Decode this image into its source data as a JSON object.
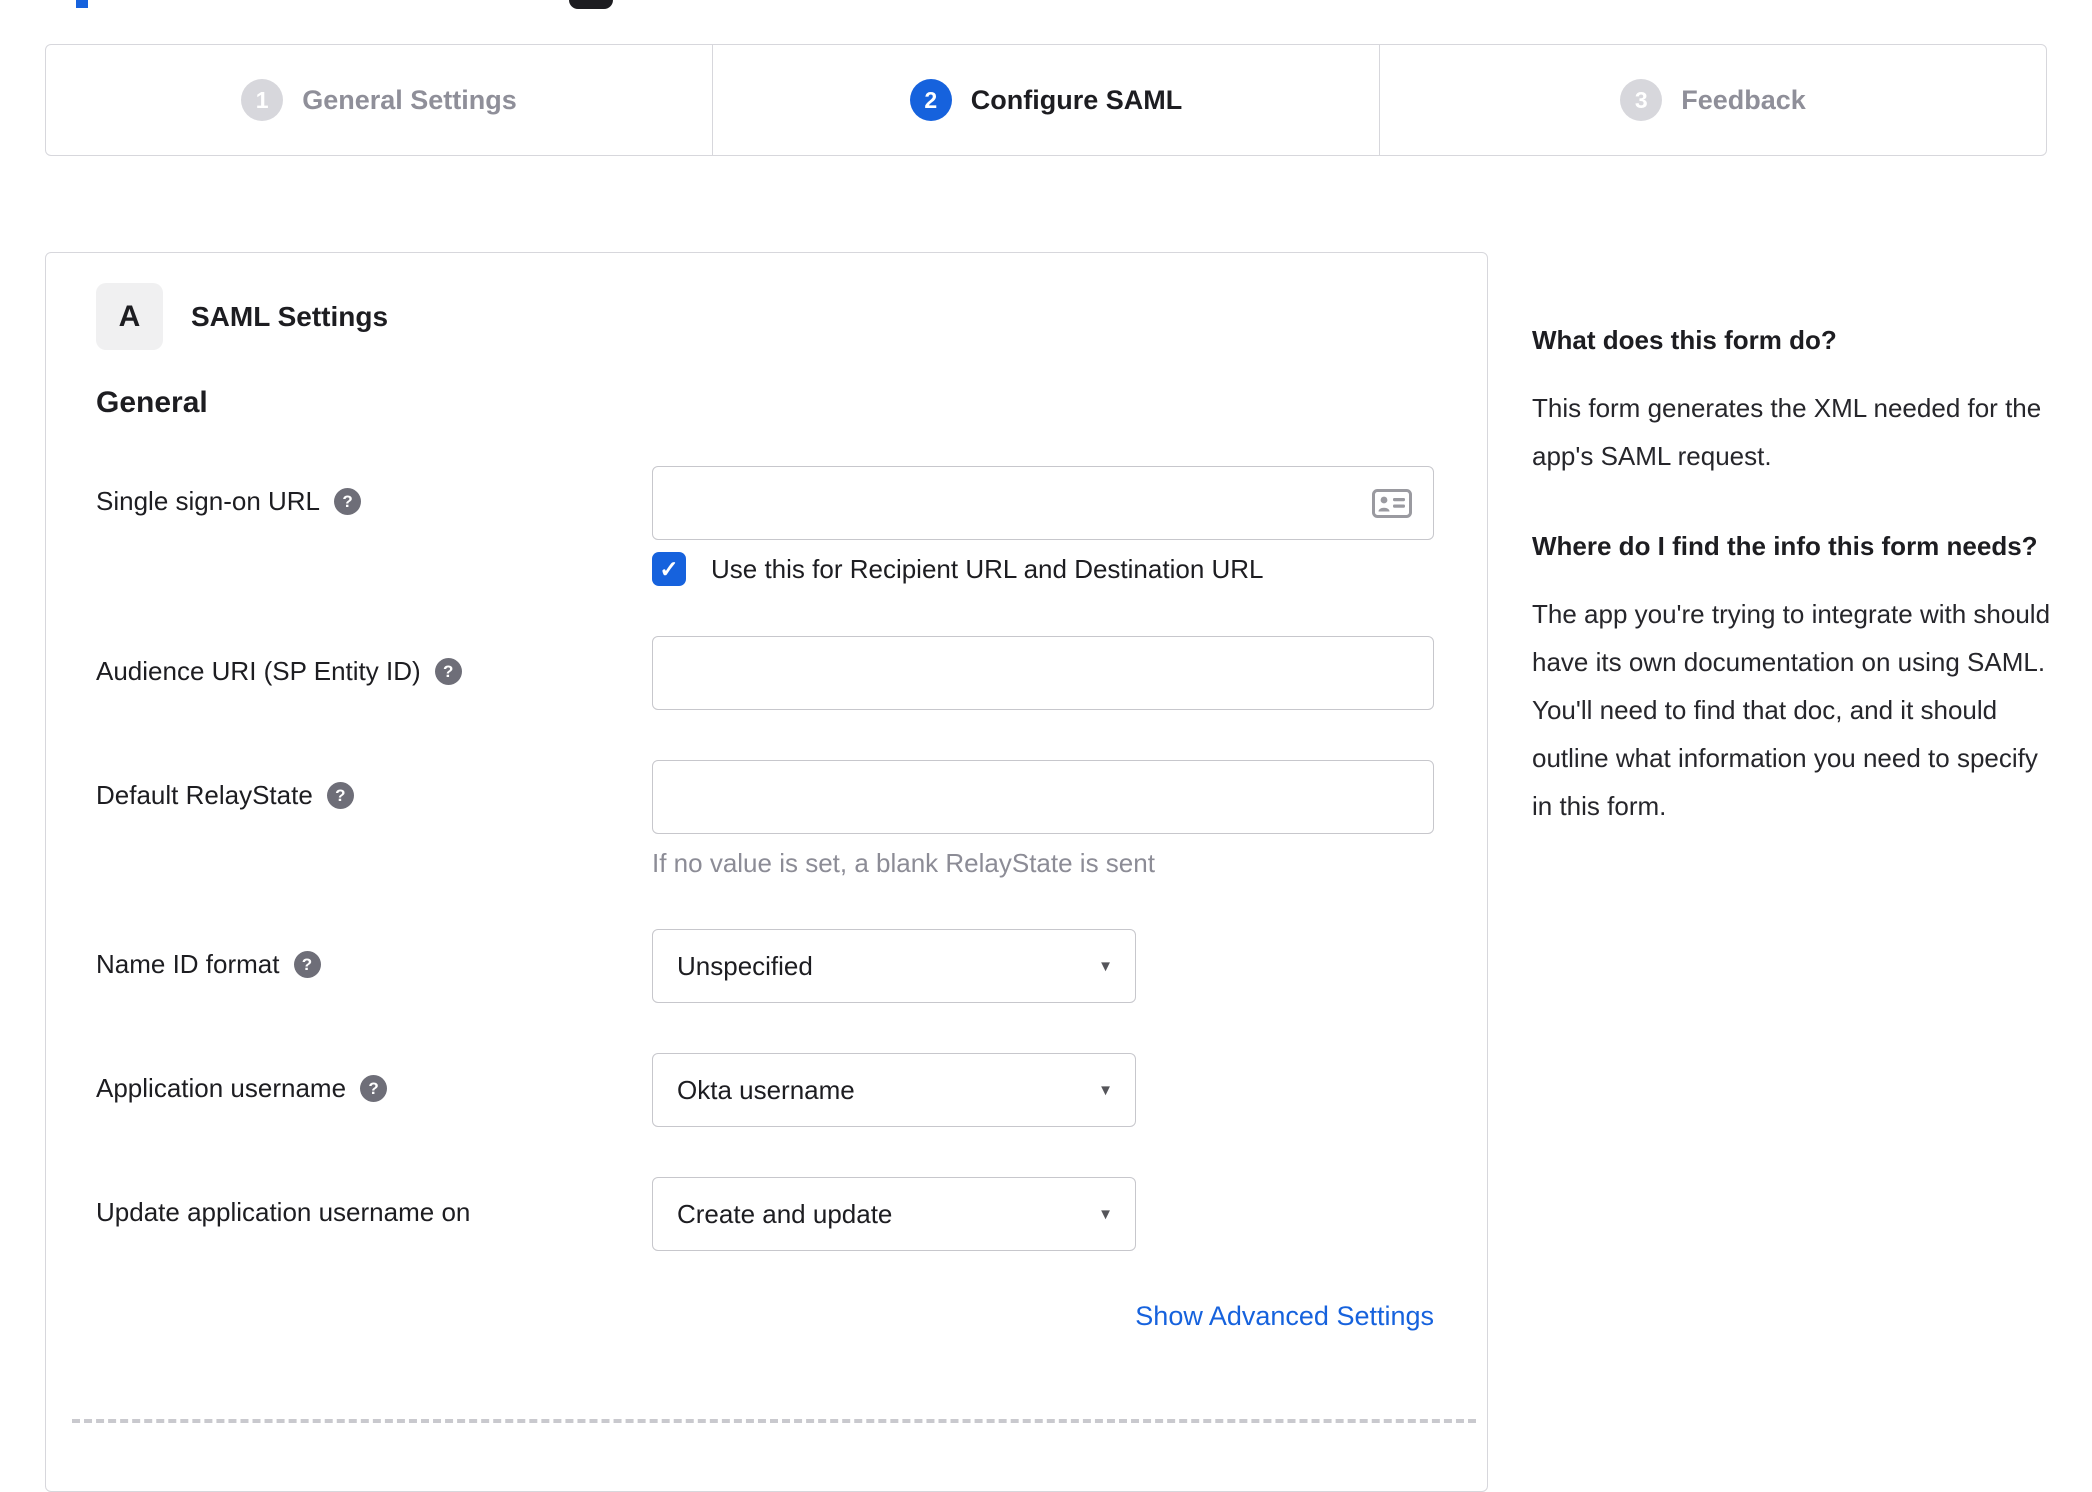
{
  "glyphs": {
    "check": "✓",
    "question": "?",
    "select_arrow": "▼"
  },
  "colors": {
    "accent_blue": "#1662dd",
    "link_blue": "#1662dd",
    "inactive_gray": "#8f8f99",
    "circle_gray": "#d7d7dc",
    "text_dark": "#1d1d21",
    "border_gray": "#d7d7dc",
    "input_border": "#c7c7cc",
    "hint_gray": "#8c8c96",
    "help_icon_gray": "#6e6e78"
  },
  "stepper": {
    "steps": [
      {
        "number": "1",
        "label": "General Settings",
        "state": "inactive"
      },
      {
        "number": "2",
        "label": "Configure SAML",
        "state": "active"
      },
      {
        "number": "3",
        "label": "Feedback",
        "state": "inactive"
      }
    ]
  },
  "form": {
    "section_badge": "A",
    "section_title": "SAML Settings",
    "group_title": "General",
    "fields": [
      {
        "label": "Single sign-on URL",
        "type": "text",
        "value": "",
        "trailing_icon": "address-card-icon",
        "checkbox_label": "Use this for Recipient URL and Destination URL",
        "checkbox_checked": true
      },
      {
        "label": "Audience URI (SP Entity ID)",
        "type": "text",
        "value": ""
      },
      {
        "label": "Default RelayState",
        "type": "text",
        "value": "",
        "hint": "If no value is set, a blank RelayState is sent"
      },
      {
        "label": "Name ID format",
        "type": "select",
        "value": "Unspecified"
      },
      {
        "label": "Application username",
        "type": "select",
        "value": "Okta username"
      },
      {
        "label": "Update application username on",
        "type": "select",
        "value": "Create and update"
      }
    ],
    "advanced_link": "Show Advanced Settings"
  },
  "help_panel": {
    "blocks": [
      {
        "heading": "What does this form do?",
        "body": "This form generates the XML needed for the app's SAML request."
      },
      {
        "heading": "Where do I find the info this form needs?",
        "body": "The app you're trying to integrate with should have its own documentation on using SAML. You'll need to find that doc, and it should outline what information you need to specify in this form."
      }
    ]
  }
}
